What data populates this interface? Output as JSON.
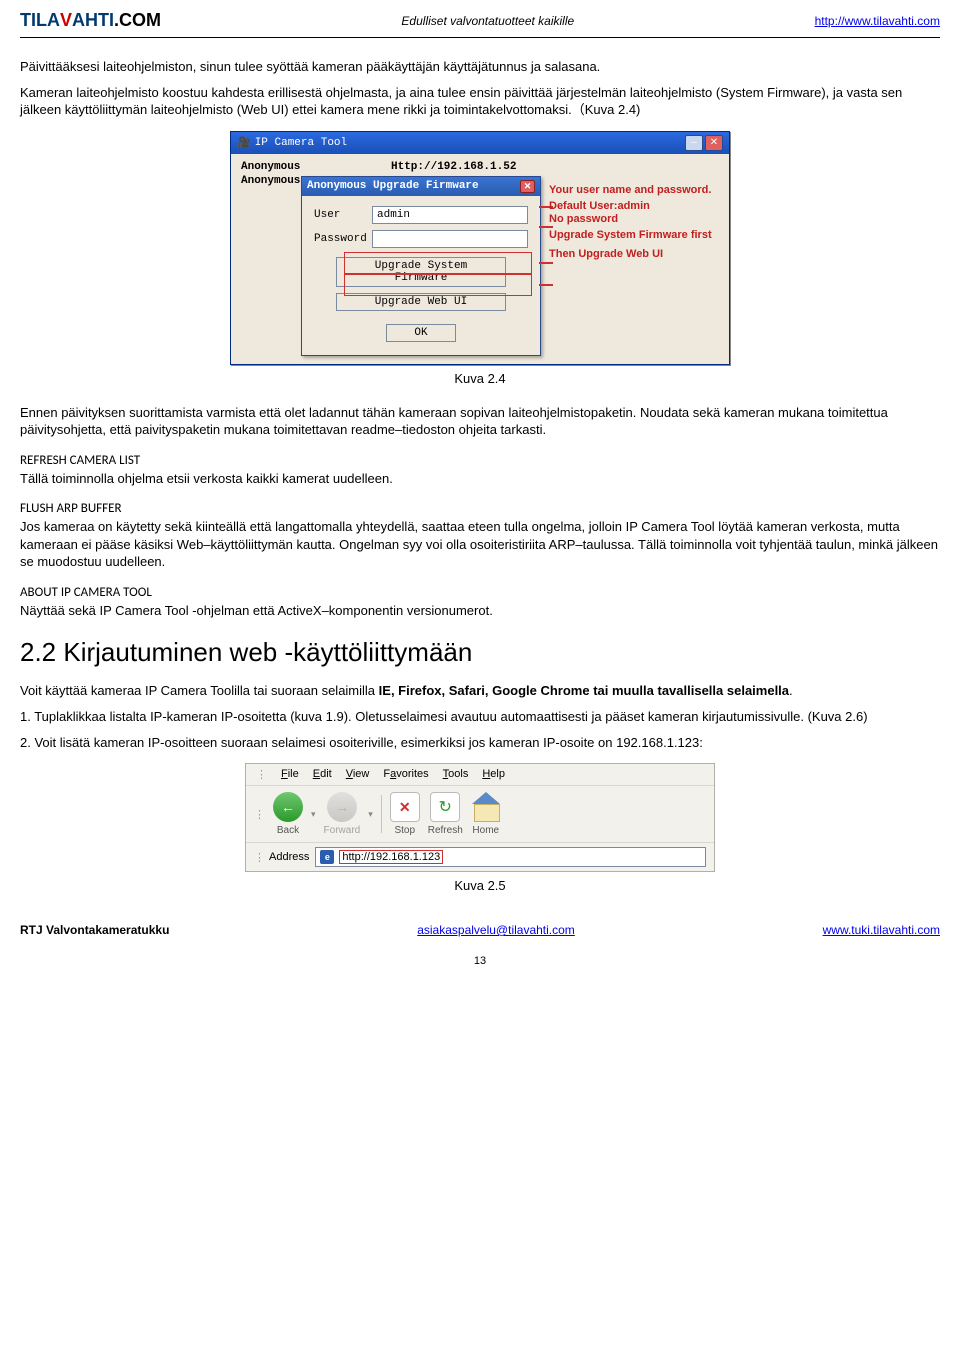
{
  "header": {
    "logo_main": "TILA",
    "logo_accent": "V",
    "logo_rest": "AHTI",
    "logo_suffix": ".COM",
    "tagline": "Edulliset valvontatuotteet kaikille",
    "url": "http://www.tilavahti.com"
  },
  "p1": "Päivittääksesi laiteohjelmiston, sinun tulee syöttää kameran pääkäyttäjän käyttäjätunnus ja salasana.",
  "p2": "Kameran laiteohjelmisto koostuu kahdesta erillisestä ohjelmasta, ja aina tulee ensin päivittää järjestelmän laiteohjelmisto (System Firmware), ja vasta sen jälkeen käyttöliittymän laiteohjelmisto (Web UI) ettei kamera mene rikki ja toimintakelvottomaksi.（Kuva 2.4)",
  "fig1": {
    "win_title": "IP Camera Tool",
    "row_name": "Anonymous",
    "row_url": "Http://192.168.1.52",
    "dlg_title": "Anonymous Upgrade Firmware",
    "user_lbl": "User",
    "user_val": "admin",
    "pass_lbl": "Password",
    "btn_sys": "Upgrade System Firmware",
    "btn_web": "Upgrade Web UI",
    "btn_ok": "OK",
    "annot1": "Your user name and password.",
    "annot2": "Default User:admin",
    "annot3": "No password",
    "annot4": "Upgrade System Firmware first",
    "annot5": "Then Upgrade Web UI",
    "caption": "Kuva 2.4"
  },
  "p3": "Ennen päivityksen suorittamista varmista että olet ladannut tähän kameraan sopivan laiteohjelmistopaketin. Noudata sekä kameran mukana toimitettua päivitysohjetta, että paivityspaketin mukana toimitettavan readme–tiedoston ohjeita tarkasti.",
  "sec1_title": "REFRESH CAMERA LIST",
  "sec1_body": "Tällä toiminnolla ohjelma etsii verkosta kaikki kamerat uudelleen.",
  "sec2_title": "FLUSH ARP BUFFER",
  "sec2_body": "Jos kameraa on käytetty sekä kiinteällä että langattomalla yhteydellä, saattaa eteen tulla ongelma, jolloin IP Camera Tool löytää kameran verkosta, mutta kameraan ei pääse käsiksi Web–käyttöliittymän kautta. Ongelman syy voi olla osoiteristiriita ARP–taulussa. Tällä toiminnolla voit tyhjentää taulun, minkä jälkeen se muodostuu uudelleen.",
  "sec3_title": "ABOUT IP CAMERA TOOL",
  "sec3_body": "Näyttää sekä IP Camera Tool -ohjelman että ActiveX–komponentin versionumerot.",
  "h2": "2.2 Kirjautuminen web -käyttöliittymään",
  "p4a": "Voit käyttää kameraa IP Camera Toolilla tai suoraan selaimilla ",
  "p4b": "IE, Firefox, Safari, Google Chrome tai muulla tavallisella selaimella",
  "p4c": ".",
  "p5": "1. Tuplaklikkaa listalta IP-kameran IP-osoitetta (kuva 1.9). Oletusselaimesi avautuu automaattisesti ja pääset kameran kirjautumissivulle. (Kuva 2.6)",
  "p6": "2. Voit lisätä kameran IP-osoitteen suoraan selaimesi osoiteriville, esimerkiksi jos kameran IP-osoite on 192.168.1.123:",
  "fig2": {
    "menu": [
      "File",
      "Edit",
      "View",
      "Favorites",
      "Tools",
      "Help"
    ],
    "tools": {
      "back": "Back",
      "forward": "Forward",
      "stop": "Stop",
      "refresh": "Refresh",
      "home": "Home"
    },
    "addr_label": "Address",
    "addr_val": "http://192.168.1.123",
    "caption": "Kuva 2.5"
  },
  "footer": {
    "left": "RTJ Valvontakameratukku",
    "mid": "asiakaspalvelu@tilavahti.com",
    "right": "www.tuki.tilavahti.com"
  },
  "pagenum": "13"
}
